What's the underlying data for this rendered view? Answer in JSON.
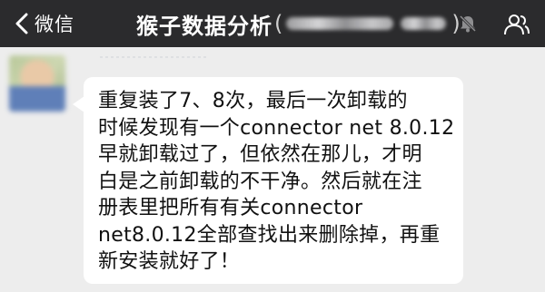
{
  "nav": {
    "back_label": "微信",
    "title": "猴子数据分析",
    "title_open_paren": "(",
    "title_close_paren": ")",
    "mute_icon": "bell-slash-icon",
    "profile_icon": "group-profile-icon",
    "background": "#2b2b2d"
  },
  "message": {
    "sender_avatar": "blurred-avatar",
    "lines": [
      "重复装了7、8次，最后一次卸载的",
      "时候发现有一个connector net 8.0.12",
      "早就卸载过了，但依然在那儿，才明",
      "白是之前卸载的不干净。然后就在注",
      "册表里把所有有关connector",
      "net8.0.12全部查找出来删除掉，再重",
      "新安装就好了！"
    ],
    "bubble_color": "#ffffff",
    "chat_background": "#ededed"
  }
}
